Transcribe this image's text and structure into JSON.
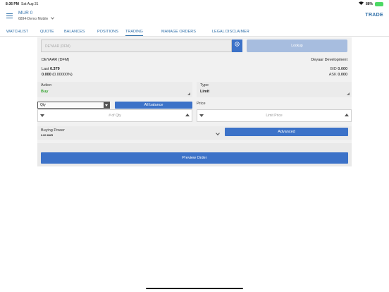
{
  "status_bar": {
    "time": "8:36 PM",
    "date": "Sat Aug 31",
    "battery": "88%"
  },
  "header": {
    "account_title": "MUR 0",
    "account_sub": "6894-Demo Mobile",
    "trade_label": "TRADE"
  },
  "tabs": [
    {
      "label": "WATCHLIST"
    },
    {
      "label": "QUOTE"
    },
    {
      "label": "BALANCES"
    },
    {
      "label": "POSITIONS"
    },
    {
      "label": "TRADING",
      "active": true
    },
    {
      "label": "MANAGE ORDERS"
    },
    {
      "label": "LEGAL DISCLAIMER"
    }
  ],
  "lookup": {
    "symbol_placeholder": "DEYAAR (DFM)",
    "lookup_label": "Lookup"
  },
  "instrument": {
    "symbol": "DEYAAR (DFM)",
    "name": "Deyaar Development",
    "last_label": "Last",
    "last_value": "0.379",
    "change": "0.000",
    "change_pct": "(0.00000%)",
    "bid_label": "BID",
    "bid_value": "0.000",
    "ask_label": "ASK",
    "ask_value": "0.000"
  },
  "order": {
    "action_label": "Action",
    "action_value": "Buy",
    "type_label": "Type",
    "type_value": "Limit",
    "qty_select_value": "Qty",
    "all_balance_label": "All balance",
    "qty_placeholder": "# of Qty",
    "price_label": "Price",
    "price_placeholder": "Limit Price",
    "buying_power_label": "Buying Power",
    "buying_power_value": "0.00 MUR",
    "advanced_label": "Advanced",
    "preview_label": "Preview Order"
  },
  "colors": {
    "accent": "#3c72c8",
    "brand_text": "#2f6fa8",
    "buy": "#3aa635"
  }
}
